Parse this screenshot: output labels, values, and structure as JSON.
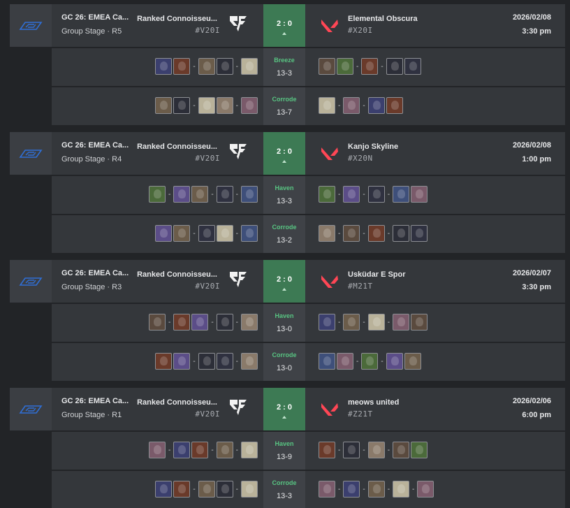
{
  "matches": [
    {
      "event_title": "GC 26: EMEA Ca...",
      "stage": "Group Stage · R5",
      "left_team": {
        "name": "Ranked Connoisseu...",
        "tag": "#V20I"
      },
      "score": "2 : 0",
      "right_team": {
        "name": "Elemental Obscura",
        "tag": "#X20I"
      },
      "date": "2026/02/08",
      "time": "3:30 pm",
      "maps": [
        {
          "name": "Breeze",
          "score": "13-3"
        },
        {
          "name": "Corrode",
          "score": "13-7"
        }
      ]
    },
    {
      "event_title": "GC 26: EMEA Ca...",
      "stage": "Group Stage · R4",
      "left_team": {
        "name": "Ranked Connoisseu...",
        "tag": "#V20I"
      },
      "score": "2 : 0",
      "right_team": {
        "name": "Kanjo Skyline",
        "tag": "#X20N"
      },
      "date": "2026/02/08",
      "time": "1:00 pm",
      "maps": [
        {
          "name": "Haven",
          "score": "13-3"
        },
        {
          "name": "Corrode",
          "score": "13-2"
        }
      ]
    },
    {
      "event_title": "GC 26: EMEA Ca...",
      "stage": "Group Stage · R3",
      "left_team": {
        "name": "Ranked Connoisseu...",
        "tag": "#V20I"
      },
      "score": "2 : 0",
      "right_team": {
        "name": "Usküdar E Spor",
        "tag": "#M21T"
      },
      "date": "2026/02/07",
      "time": "3:30 pm",
      "maps": [
        {
          "name": "Haven",
          "score": "13-0"
        },
        {
          "name": "Corrode",
          "score": "13-0"
        }
      ]
    },
    {
      "event_title": "GC 26: EMEA Ca...",
      "stage": "Group Stage · R1",
      "left_team": {
        "name": "Ranked Connoisseu...",
        "tag": "#V20I"
      },
      "score": "2 : 0",
      "right_team": {
        "name": "meows united",
        "tag": "#Z21T"
      },
      "date": "2026/02/06",
      "time": "6:00 pm",
      "maps": [
        {
          "name": "Haven",
          "score": "13-9"
        },
        {
          "name": "Corrode",
          "score": "13-3"
        }
      ]
    }
  ],
  "colors": {
    "background": "#222427",
    "row": "#34373b",
    "score_win": "#3d7a54",
    "map_name": "#58c482",
    "valorant_red": "#ff4655",
    "event_logo_blue": "#2f6fd6"
  },
  "icons": {
    "event_logo": "gc-event-logo-icon",
    "left_team_logo": "rc-team-logo-icon",
    "right_team_logo": "valorant-logo-icon",
    "expand": "caret-up-icon"
  }
}
